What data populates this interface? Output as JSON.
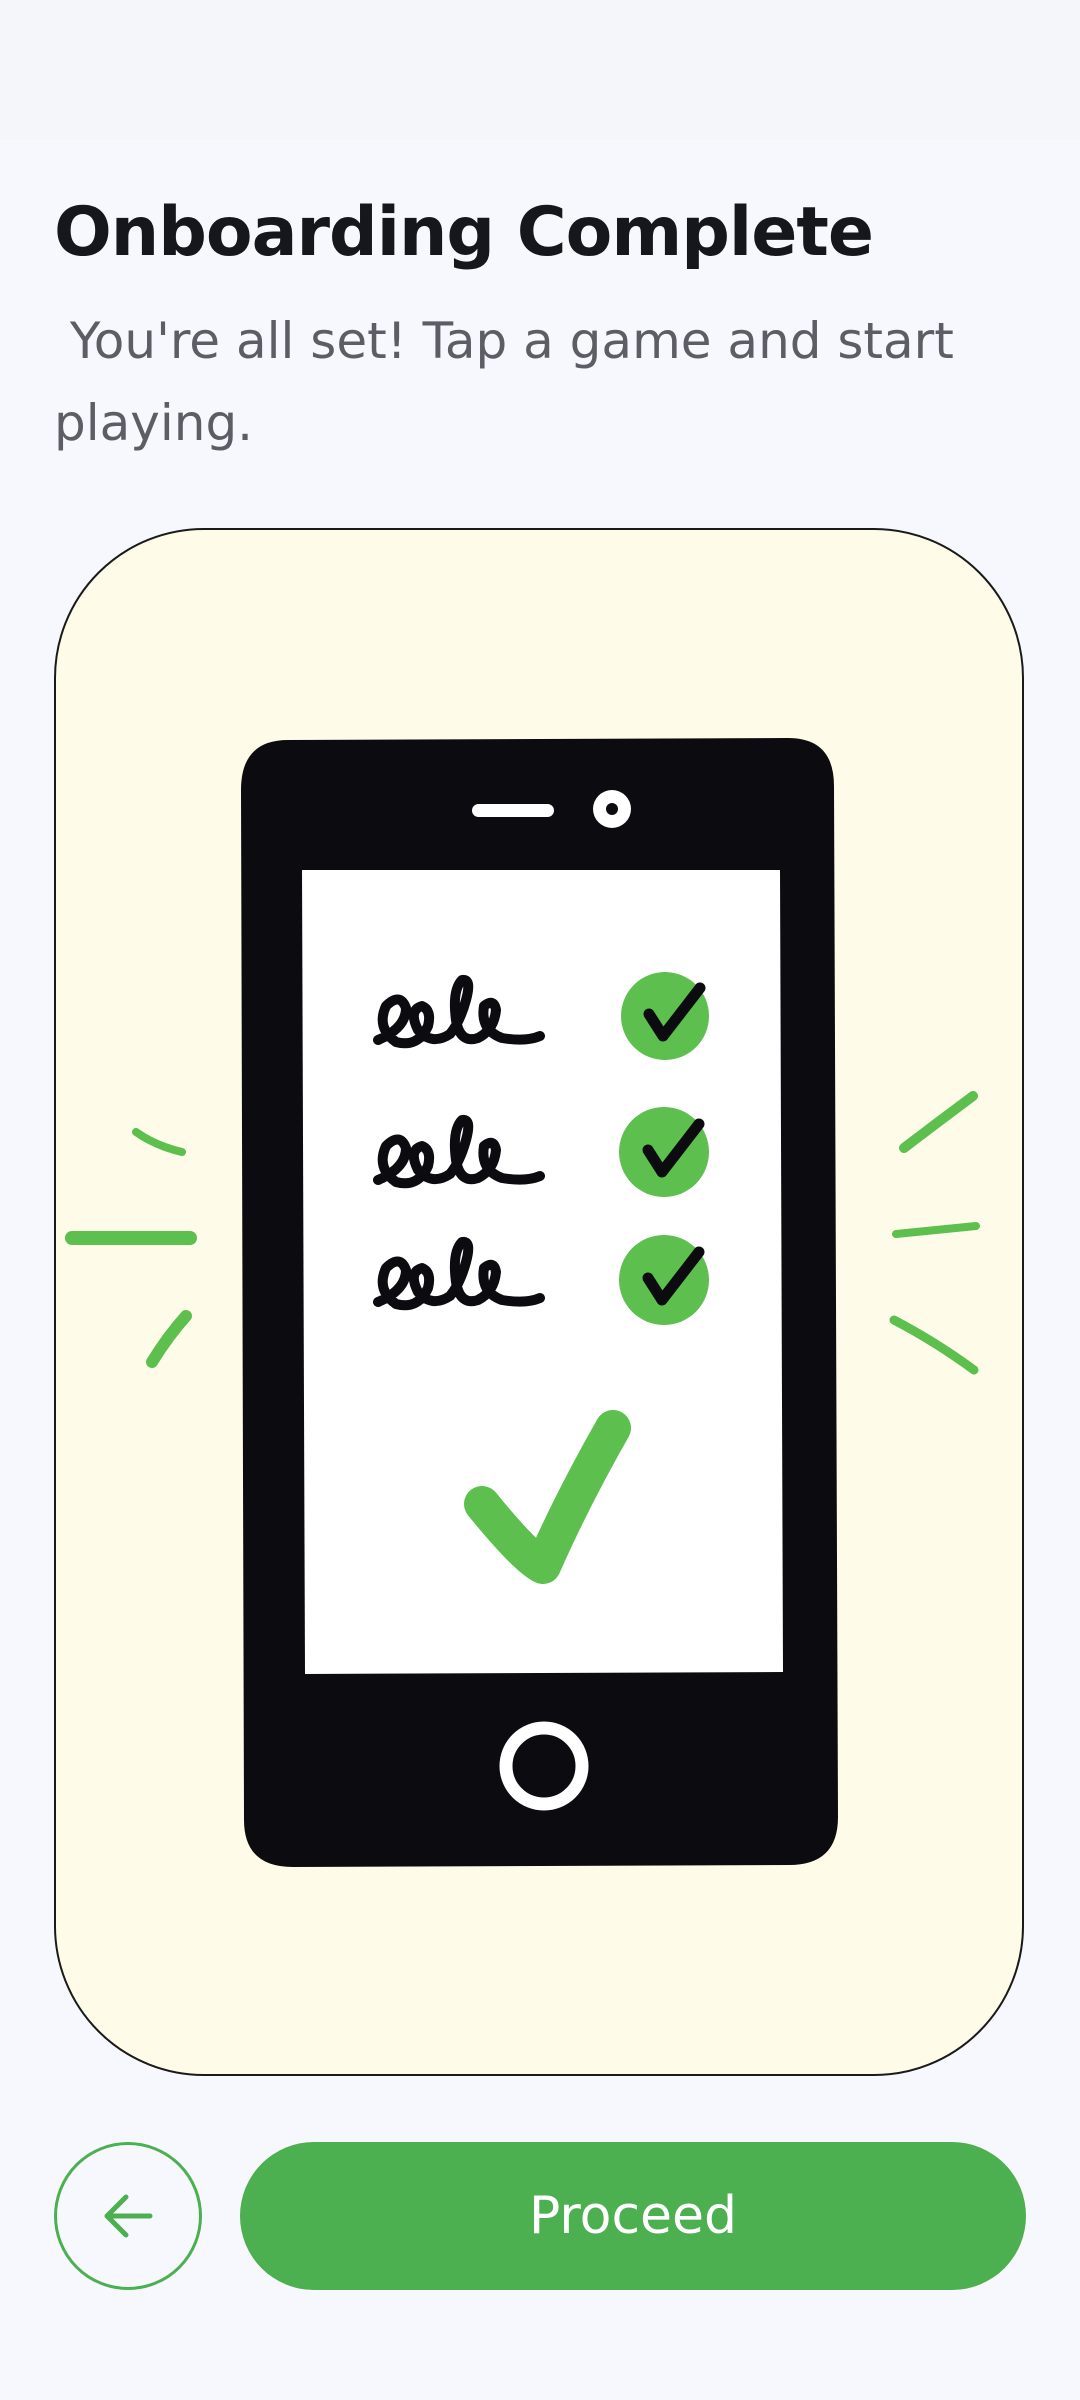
{
  "screen": {
    "title": "Onboarding Complete",
    "subtitle": " You're all set! Tap a game and start playing."
  },
  "illustration": {
    "description_icon": "phone-checklist-illustration",
    "colors": {
      "card_background": "#fefce8",
      "phone_body": "#0c0c10",
      "screen": "#ffffff",
      "accent_green": "#5cbf4e"
    }
  },
  "actions": {
    "back_icon": "arrow-left-icon",
    "proceed_label": "Proceed"
  },
  "colors": {
    "primary": "#4caf50",
    "background": "#f7f8fd",
    "title": "#16161d",
    "subtitle": "#5d5d66"
  }
}
